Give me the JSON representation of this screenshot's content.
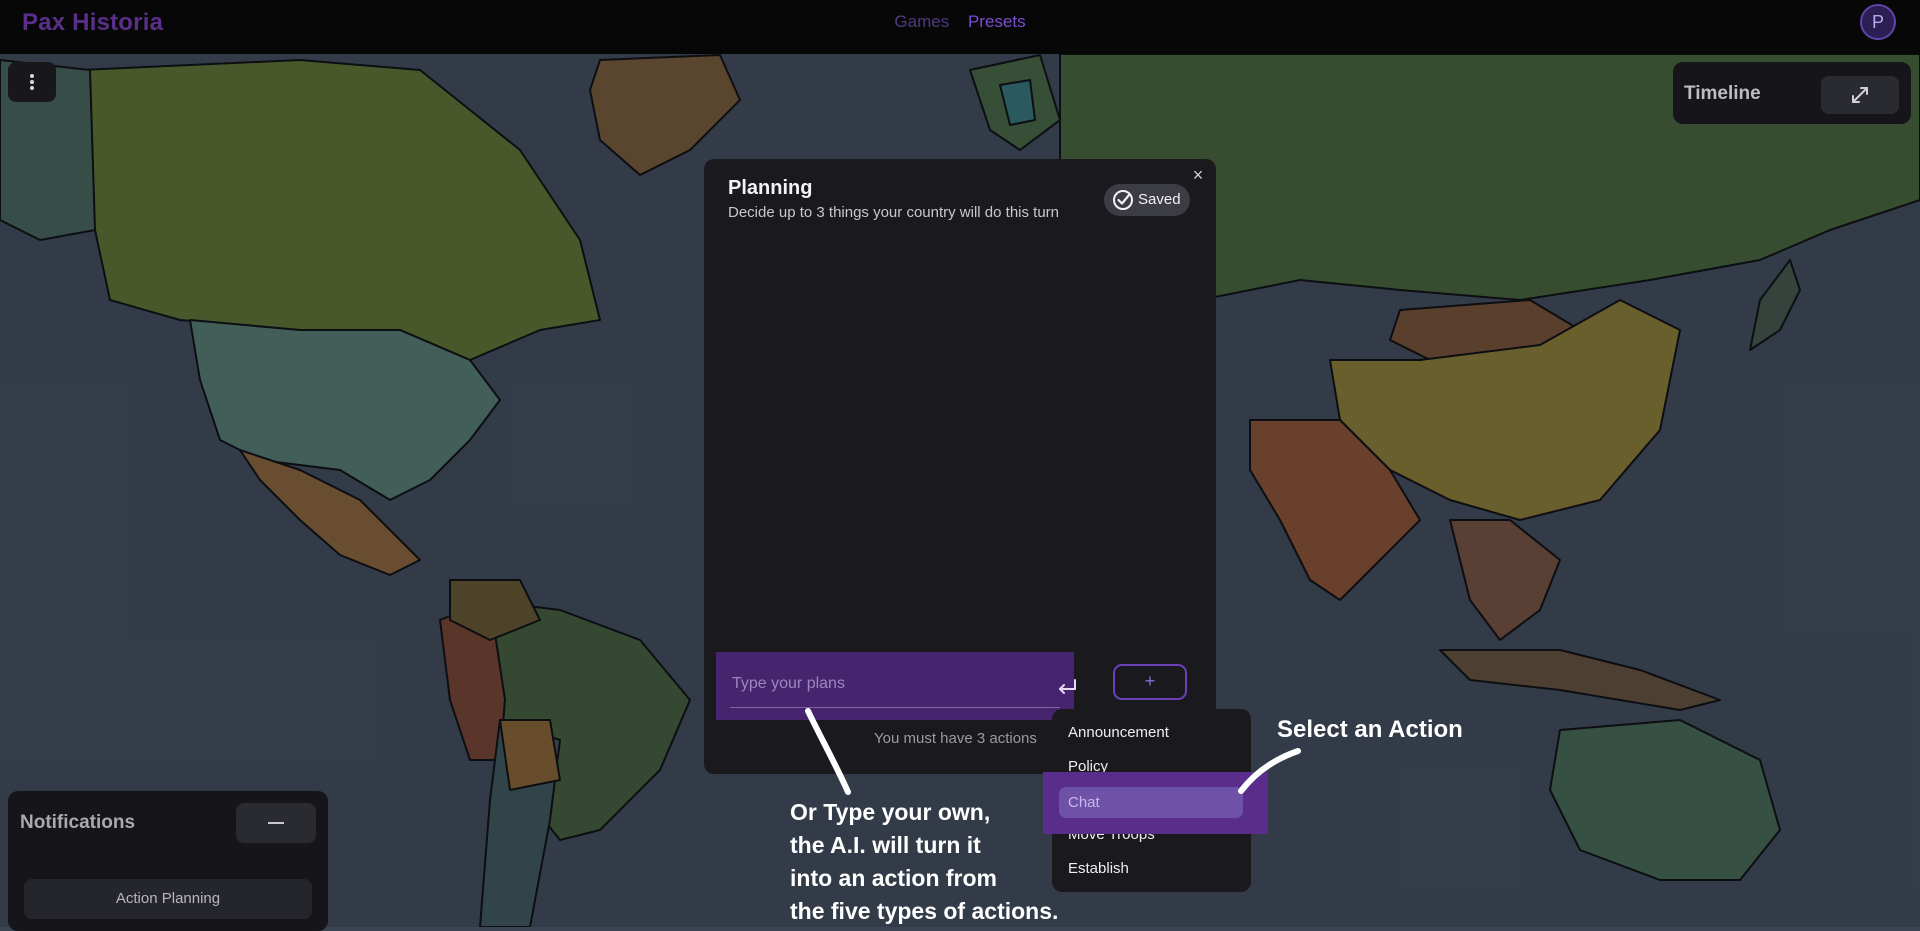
{
  "app": {
    "brand": "Pax Historia",
    "nav": {
      "games": "Games",
      "presets": "Presets"
    },
    "avatar_initial": "P"
  },
  "map_controls": {
    "timeline_title": "Timeline",
    "notifications_title": "Notifications",
    "notification_item": "Action Planning"
  },
  "planning": {
    "title": "Planning",
    "subtitle": "Decide up to 3 things your country will do this turn",
    "saved_label": "Saved",
    "input_placeholder": "Type your plans",
    "add_label": "+",
    "requirement_text": "You must have 3 actions"
  },
  "action_menu": {
    "items": [
      "Announcement",
      "Policy",
      "Chat",
      "Move Troops",
      "Establish"
    ],
    "highlighted": "Chat"
  },
  "annotations": {
    "select_action": "Select an Action",
    "type_own": [
      "Or Type your own,",
      "the A.I. will turn it",
      "into an action from",
      "the five types of actions."
    ]
  },
  "colors": {
    "accent_purple": "#47256e",
    "highlight_purple": "#5a2c8c",
    "brand_purple": "#5a2f8a",
    "map_ocean": "#3a4452"
  },
  "icons": [
    "kebab-menu-icon",
    "expand-icon",
    "minimize-icon",
    "check-circle-icon",
    "close-icon",
    "enter-icon",
    "plus-icon"
  ]
}
